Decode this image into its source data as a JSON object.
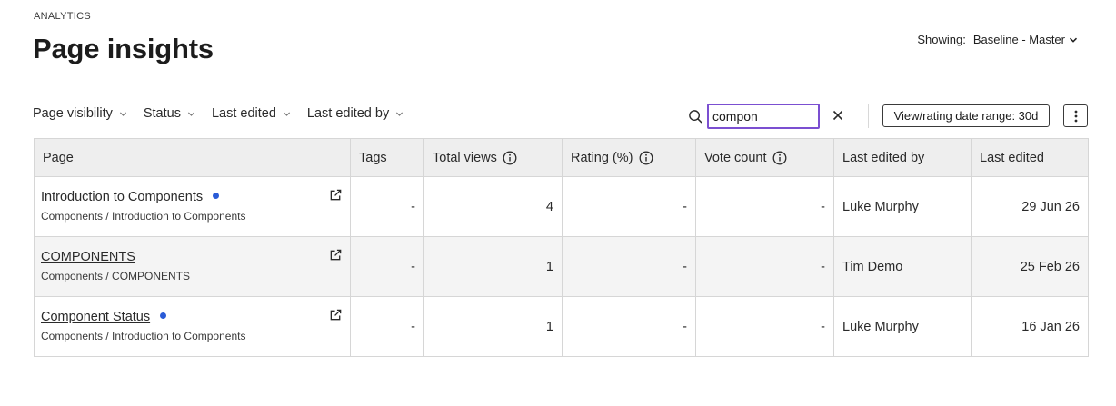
{
  "header": {
    "eyebrow": "ANALYTICS",
    "title": "Page insights"
  },
  "showing": {
    "label": "Showing:",
    "value": "Baseline - Master"
  },
  "filters": [
    {
      "label": "Page visibility"
    },
    {
      "label": "Status"
    },
    {
      "label": "Last edited"
    },
    {
      "label": "Last edited by"
    }
  ],
  "search": {
    "value": "compon"
  },
  "date_range_button": "View/rating date range: 30d",
  "colors": {
    "accent": "#7b4fd1",
    "dot": "#2a5bd7",
    "header_bg": "#eeeeee"
  },
  "table": {
    "headers": [
      "Page",
      "Tags",
      "Total views",
      "Rating (%)",
      "Vote count",
      "Last edited by",
      "Last edited"
    ],
    "rows": [
      {
        "title": "Introduction to Components",
        "has_dot": true,
        "path": "Components / Introduction to Components",
        "tags": "-",
        "views": "4",
        "rating": "-",
        "votes": "-",
        "editor": "Luke Murphy",
        "edited": "29 Jun 26"
      },
      {
        "title": "COMPONENTS",
        "has_dot": false,
        "path": "Components / COMPONENTS",
        "tags": "-",
        "views": "1",
        "rating": "-",
        "votes": "-",
        "editor": "Tim Demo",
        "edited": "25 Feb 26"
      },
      {
        "title": "Component Status",
        "has_dot": true,
        "path": "Components / Introduction to Components",
        "tags": "-",
        "views": "1",
        "rating": "-",
        "votes": "-",
        "editor": "Luke Murphy",
        "edited": "16 Jan 26"
      }
    ]
  }
}
